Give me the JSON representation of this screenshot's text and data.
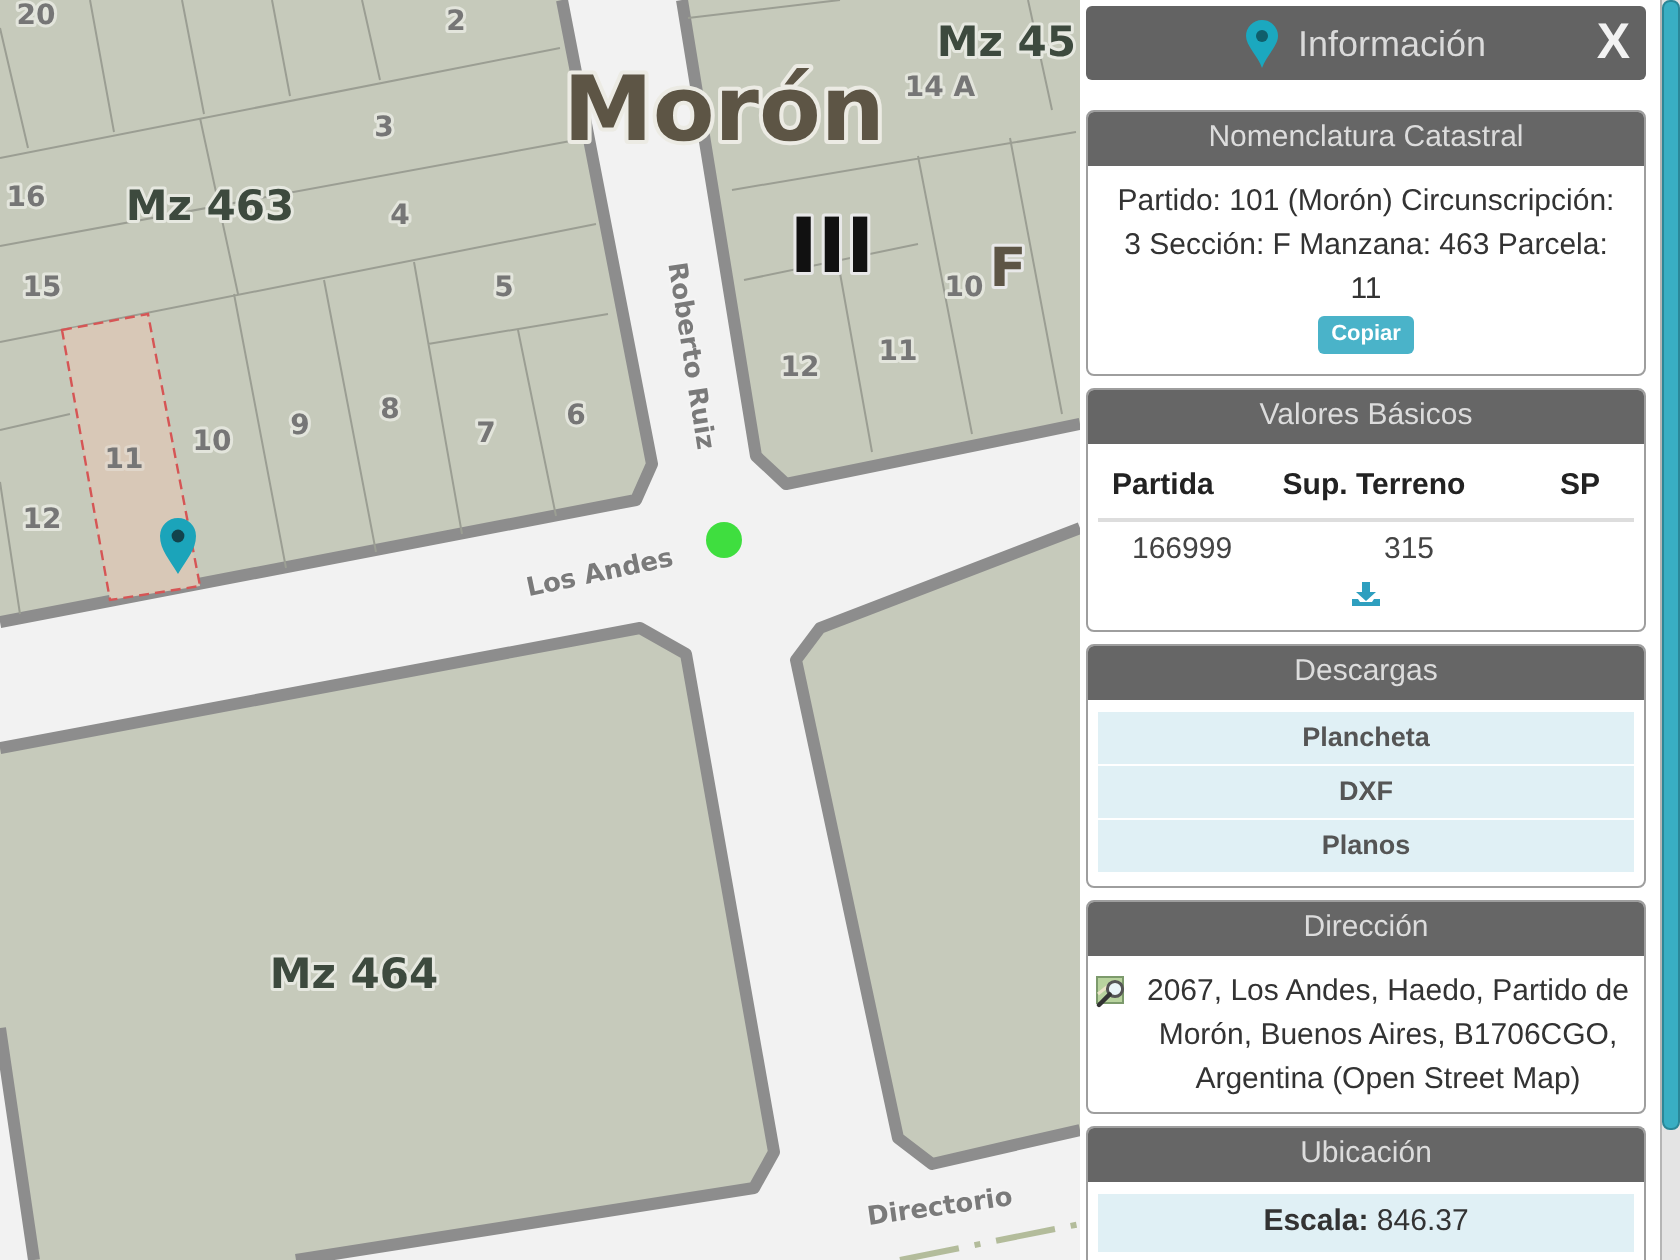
{
  "map": {
    "labels": [
      {
        "kind": "lot",
        "text": "20"
      },
      {
        "kind": "lot",
        "text": "2"
      },
      {
        "kind": "block",
        "text": "Mz 45"
      },
      {
        "kind": "lot",
        "text": "14 A"
      },
      {
        "kind": "lot",
        "text": "3"
      },
      {
        "kind": "place",
        "text": "Morón"
      },
      {
        "kind": "lot",
        "text": "16"
      },
      {
        "kind": "block",
        "text": "Mz 463"
      },
      {
        "kind": "lot",
        "text": "4"
      },
      {
        "kind": "district",
        "text": "III"
      },
      {
        "kind": "lot",
        "text": "15"
      },
      {
        "kind": "lot",
        "text": "5"
      },
      {
        "kind": "lot",
        "text": "10"
      },
      {
        "kind": "section",
        "text": "F"
      },
      {
        "kind": "lot",
        "text": "11"
      },
      {
        "kind": "lot",
        "text": "12"
      },
      {
        "kind": "lot",
        "text": "10"
      },
      {
        "kind": "lot",
        "text": "9"
      },
      {
        "kind": "lot",
        "text": "8"
      },
      {
        "kind": "lot",
        "text": "7"
      },
      {
        "kind": "lot",
        "text": "6"
      },
      {
        "kind": "lot",
        "text": "12"
      },
      {
        "kind": "block",
        "text": "Mz 464"
      }
    ],
    "streets": [
      "Roberto Ruiz",
      "Los Andes",
      "Directorio"
    ],
    "selected_parcel": {
      "label": "11"
    }
  },
  "panel": {
    "title": "Información",
    "close_label": "X",
    "cards": [
      {
        "kind": "text",
        "title": "Nomenclatura Catastral",
        "text": "Partido: 101 (Morón) Circunscripción: 3 Sección: F Manzana: 463 Parcela: 11",
        "button": "Copiar"
      },
      {
        "kind": "table",
        "title": "Valores Básicos",
        "columns": [
          "Partida",
          "Sup. Terreno",
          "SP"
        ],
        "rows": [
          [
            "166999",
            "315"
          ]
        ]
      },
      {
        "kind": "links",
        "title": "Descargas",
        "items": [
          "Plancheta",
          "DXF",
          "Planos"
        ]
      },
      {
        "kind": "address",
        "title": "Dirección",
        "text": "2067, Los Andes, Haedo, Partido de Morón, Buenos Aires, B1706CGO, Argentina (Open Street Map)"
      },
      {
        "kind": "rows",
        "title": "Ubicación",
        "items": [
          "**Escala:** 846.37"
        ]
      }
    ]
  }
}
